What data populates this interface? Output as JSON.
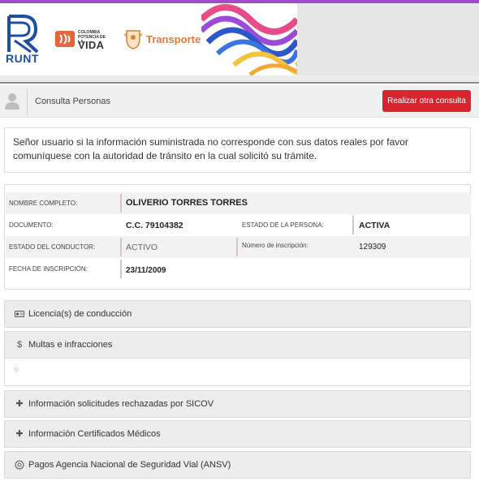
{
  "banner": {
    "runt_text": "RUNT",
    "colombia_small": "COLOMBIA POTENCIA DE LA",
    "colombia_vida": "VIDA",
    "transporte": "Transporte",
    "colors": {
      "runt_blue": "#1f4f9c",
      "transporte_orange": "#e07a3a",
      "accent_purple": "#a14ccf"
    }
  },
  "header": {
    "title": "Consulta Personas",
    "button_label": "Realizar otra consulta",
    "user_icon": "user-icon",
    "button_color": "#d9262e"
  },
  "notice": {
    "text": "Señor usuario si la información suministrada no corresponde con sus datos reales por favor comuníquese con la autoridad de tránsito en la cual solicitó su trámite."
  },
  "person": {
    "nombre_label": "NOMBRE COMPLETO:",
    "nombre_value": "OLIVERIO TORRES TORRES",
    "documento_label": "DOCUMENTO:",
    "documento_value": "C.C. 79104382",
    "estado_persona_label": "ESTADO DE LA PERSONA:",
    "estado_persona_value": "ACTIVA",
    "estado_conductor_label": "ESTADO DEL CONDUCTOR:",
    "estado_conductor_value": "ACTIVO",
    "numero_inscripcion_label": "Número de inscripción:",
    "numero_inscripcion_value": "129309",
    "fecha_inscripcion_label": "FECHA DE INSCRIPCIÓN:",
    "fecha_inscripcion_value": "23/11/2009"
  },
  "sections": [
    {
      "label": "Licencia(s) de conducción",
      "icon": "id-card-icon"
    },
    {
      "label": "Multas e infracciones",
      "icon": "dollar-icon"
    },
    {
      "label": "Información solicitudes rechazadas por SICOV",
      "icon": "plus-icon"
    },
    {
      "label": "Información Certificados Médicos",
      "icon": "plus-icon"
    },
    {
      "label": "Pagos Agencia Nacional de Seguridad Vial (ANSV)",
      "icon": "payments-icon"
    }
  ],
  "glyphs": {
    "dollar": "$",
    "plus": "✚",
    "loading": "⁘"
  }
}
